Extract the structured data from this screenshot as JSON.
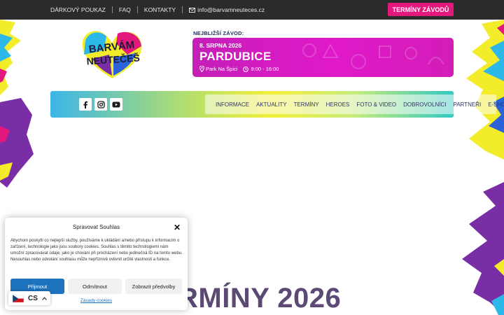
{
  "topbar": {
    "links": [
      "DÁRKOVÝ POUKAZ",
      "FAQ",
      "KONTAKTY"
    ],
    "email": "info@barvamneuteces.cz",
    "cta_label": "TERMÍNY ZÁVODŮ"
  },
  "logo": {
    "line1": "BARVÁM",
    "line2": "NEUTEČEŠ"
  },
  "next_event": {
    "label": "NEJBLIŽŠÍ ZÁVOD:",
    "date": "8. SRPNA 2026",
    "city": "PARDUBICE",
    "place": "Park Na Špici",
    "time": "9:00 - 16:00"
  },
  "menu": {
    "items": [
      "INFORMACE",
      "AKTUALITY",
      "TERMÍNY",
      "HEROES",
      "FOTO & VIDEO",
      "DOBROVOLNÍCI",
      "PARTNEŘI",
      "E-SHOP"
    ]
  },
  "heading": "RMÍNY 2026",
  "cookie": {
    "title": "Spravovat Souhlas",
    "text": "Abychom poskytli co nejlepší služby, používáme k ukládání a/nebo přístupu k informacím o zařízení, technologie jako jsou soubory cookies. Souhlas s těmito technologiemi nám umožní zpracovávat údaje, jako je chování při procházení nebo jedinečná ID na tomto webu. Nesouhlas nebo odvolání souhlasu může nepříznivě ovlivnit určité vlastnosti a funkce.",
    "accept": "Přijmout",
    "deny": "Odmítnout",
    "prefs": "Zobrazit předvolby",
    "policy": "Zásady cookies"
  },
  "language": {
    "code": "CS"
  },
  "colors": {
    "cta": "#e3187d",
    "event": "#e019c9",
    "accept": "#1e73be",
    "topbar": "#2b2b2b"
  }
}
